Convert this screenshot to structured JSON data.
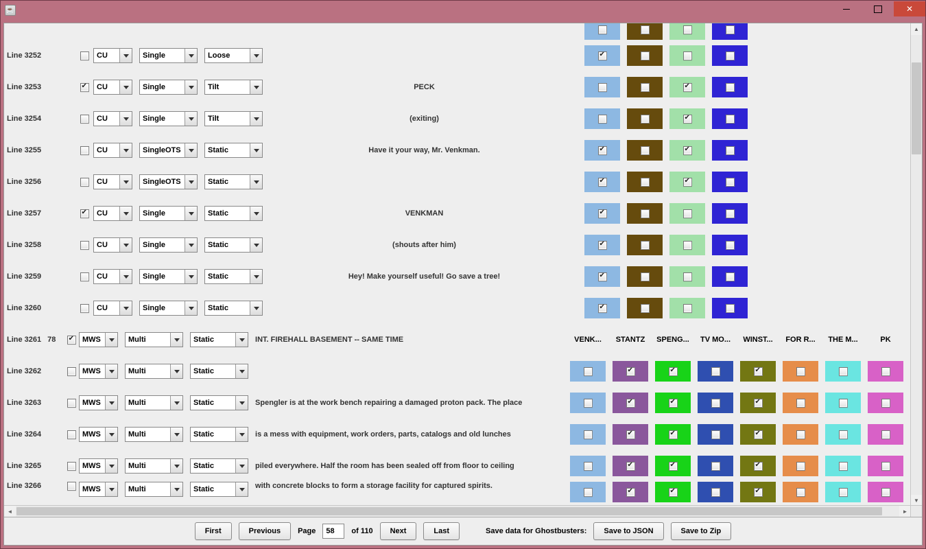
{
  "window": {
    "title": ""
  },
  "colors": {
    "c0": "#8db8e2",
    "c1": "#664b0d",
    "c2": "#a2e0a9",
    "c3": "#2f24d4",
    "c4": "#8a579c",
    "c5": "#18d318",
    "c6": "#2f4fb0",
    "c7": "#737713",
    "c8": "#e68d4a",
    "c9": "#6ae5e1",
    "c10": "#d861c7"
  },
  "header_labels": [
    "VENK...",
    "STANTZ",
    "SPENG...",
    "TV MO...",
    "WINST...",
    "FOR R...",
    "THE M...",
    "PK"
  ],
  "rows": [
    {
      "line": "",
      "extra": "",
      "cb": false,
      "d1": "",
      "d2": "",
      "d3": "",
      "text": "",
      "align": "left",
      "swatches": [
        [
          0,
          false
        ],
        [
          1,
          false
        ],
        [
          2,
          false
        ],
        [
          3,
          false
        ]
      ],
      "partial": "top"
    },
    {
      "line": "Line 3252",
      "extra": "",
      "cb": false,
      "d1": "CU",
      "d2": "Single",
      "d3": "Loose",
      "text": "",
      "align": "center",
      "swatches": [
        [
          0,
          true
        ],
        [
          1,
          false
        ],
        [
          2,
          false
        ],
        [
          3,
          false
        ]
      ]
    },
    {
      "line": "Line 3253",
      "extra": "",
      "cb": true,
      "d1": "CU",
      "d2": "Single",
      "d3": "Tilt",
      "text": "PECK",
      "align": "center",
      "swatches": [
        [
          0,
          false
        ],
        [
          1,
          false
        ],
        [
          2,
          true
        ],
        [
          3,
          false
        ]
      ]
    },
    {
      "line": "Line 3254",
      "extra": "",
      "cb": false,
      "d1": "CU",
      "d2": "Single",
      "d3": "Tilt",
      "text": "(exiting)",
      "align": "center",
      "swatches": [
        [
          0,
          false
        ],
        [
          1,
          false
        ],
        [
          2,
          true
        ],
        [
          3,
          false
        ]
      ]
    },
    {
      "line": "Line 3255",
      "extra": "",
      "cb": false,
      "d1": "CU",
      "d2": "SingleOTS",
      "d3": "Static",
      "text": "Have it your way, Mr. Venkman.",
      "align": "center",
      "swatches": [
        [
          0,
          true
        ],
        [
          1,
          false
        ],
        [
          2,
          true
        ],
        [
          3,
          false
        ]
      ]
    },
    {
      "line": "Line 3256",
      "extra": "",
      "cb": false,
      "d1": "CU",
      "d2": "SingleOTS",
      "d3": "Static",
      "text": "",
      "align": "center",
      "swatches": [
        [
          0,
          true
        ],
        [
          1,
          false
        ],
        [
          2,
          true
        ],
        [
          3,
          false
        ]
      ]
    },
    {
      "line": "Line 3257",
      "extra": "",
      "cb": true,
      "d1": "CU",
      "d2": "Single",
      "d3": "Static",
      "text": "VENKMAN",
      "align": "center",
      "swatches": [
        [
          0,
          true
        ],
        [
          1,
          false
        ],
        [
          2,
          false
        ],
        [
          3,
          false
        ]
      ]
    },
    {
      "line": "Line 3258",
      "extra": "",
      "cb": false,
      "d1": "CU",
      "d2": "Single",
      "d3": "Static",
      "text": "(shouts after him)",
      "align": "center",
      "swatches": [
        [
          0,
          true
        ],
        [
          1,
          false
        ],
        [
          2,
          false
        ],
        [
          3,
          false
        ]
      ]
    },
    {
      "line": "Line 3259",
      "extra": "",
      "cb": false,
      "d1": "CU",
      "d2": "Single",
      "d3": "Static",
      "text": "Hey!  Make yourself useful!  Go save a tree!",
      "align": "center",
      "swatches": [
        [
          0,
          true
        ],
        [
          1,
          false
        ],
        [
          2,
          false
        ],
        [
          3,
          false
        ]
      ]
    },
    {
      "line": "Line 3260",
      "extra": "",
      "cb": false,
      "d1": "CU",
      "d2": "Single",
      "d3": "Static",
      "text": "",
      "align": "center",
      "swatches": [
        [
          0,
          true
        ],
        [
          1,
          false
        ],
        [
          2,
          false
        ],
        [
          3,
          false
        ]
      ]
    },
    {
      "line": "Line 3261",
      "extra": "78",
      "cb": true,
      "d1": "MWS",
      "d2": "Multi",
      "d3": "Static",
      "text": "INT. FIREHALL BASEMENT -- SAME TIME",
      "align": "left",
      "header": true
    },
    {
      "line": "Line 3262",
      "extra": "",
      "cb": false,
      "d1": "MWS",
      "d2": "Multi",
      "d3": "Static",
      "text": "",
      "align": "left",
      "swatches": [
        [
          0,
          false
        ],
        [
          4,
          true
        ],
        [
          5,
          true
        ],
        [
          6,
          false
        ],
        [
          7,
          true
        ],
        [
          8,
          false
        ],
        [
          9,
          false
        ],
        [
          10,
          false
        ]
      ]
    },
    {
      "line": "Line 3263",
      "extra": "",
      "cb": false,
      "d1": "MWS",
      "d2": "Multi",
      "d3": "Static",
      "text": "Spengler is at the work bench repairing a damaged proton pack. The place",
      "align": "left",
      "swatches": [
        [
          0,
          false
        ],
        [
          4,
          true
        ],
        [
          5,
          true
        ],
        [
          6,
          false
        ],
        [
          7,
          true
        ],
        [
          8,
          false
        ],
        [
          9,
          false
        ],
        [
          10,
          false
        ]
      ]
    },
    {
      "line": "Line 3264",
      "extra": "",
      "cb": false,
      "d1": "MWS",
      "d2": "Multi",
      "d3": "Static",
      "text": "is a mess with equipment, work orders, parts, catalogs and old lunches",
      "align": "left",
      "swatches": [
        [
          0,
          false
        ],
        [
          4,
          true
        ],
        [
          5,
          true
        ],
        [
          6,
          false
        ],
        [
          7,
          true
        ],
        [
          8,
          false
        ],
        [
          9,
          false
        ],
        [
          10,
          false
        ]
      ]
    },
    {
      "line": "Line 3265",
      "extra": "",
      "cb": false,
      "d1": "MWS",
      "d2": "Multi",
      "d3": "Static",
      "text": "piled everywhere. Half the room has been sealed off from floor to ceiling",
      "align": "left",
      "swatches": [
        [
          0,
          false
        ],
        [
          4,
          true
        ],
        [
          5,
          true
        ],
        [
          6,
          false
        ],
        [
          7,
          true
        ],
        [
          8,
          false
        ],
        [
          9,
          false
        ],
        [
          10,
          false
        ]
      ]
    },
    {
      "line": "Line 3266",
      "extra": "",
      "cb": false,
      "d1": "MWS",
      "d2": "Multi",
      "d3": "Static",
      "text": "with concrete blocks to form a storage facility for captured spirits.",
      "align": "left",
      "swatches": [
        [
          0,
          false
        ],
        [
          4,
          true
        ],
        [
          5,
          true
        ],
        [
          6,
          false
        ],
        [
          7,
          true
        ],
        [
          8,
          false
        ],
        [
          9,
          false
        ],
        [
          10,
          false
        ]
      ],
      "partial": "bottom"
    }
  ],
  "footer": {
    "first": "First",
    "previous": "Previous",
    "page_label": "Page",
    "page_value": "58",
    "of_total": "of 110",
    "next": "Next",
    "last": "Last",
    "save_label": "Save data for Ghostbusters:",
    "save_json": "Save to JSON",
    "save_zip": "Save to Zip"
  }
}
